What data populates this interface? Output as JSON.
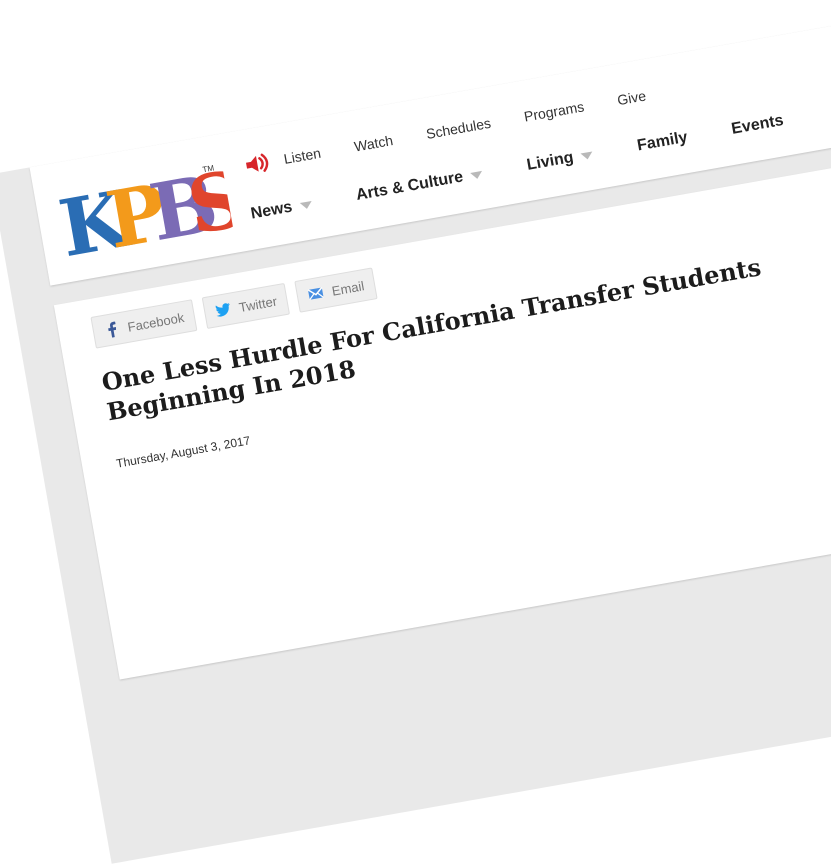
{
  "brand": {
    "logo_text": "KPBS",
    "trademark": "TM"
  },
  "utility_nav": {
    "listen": "Listen",
    "watch": "Watch",
    "schedules": "Schedules",
    "programs": "Programs",
    "give": "Give"
  },
  "main_nav": {
    "news": "News",
    "arts_culture": "Arts & Culture",
    "living": "Living",
    "family": "Family",
    "events": "Events"
  },
  "share": {
    "facebook": "Facebook",
    "twitter": "Twitter",
    "email": "Email"
  },
  "article": {
    "headline": "One Less Hurdle For California Transfer Students Beginning In 2018",
    "date": "Thursday, August 3, 2017"
  },
  "colors": {
    "speaker_red": "#d7262b",
    "facebook_blue": "#3b5998",
    "twitter_blue": "#1da1f2",
    "email_blue": "#4a90e2",
    "logo_blue": "#2a6db4",
    "logo_orange": "#f39a1b",
    "logo_red": "#e0452c",
    "logo_purple": "#7b6bb5"
  }
}
